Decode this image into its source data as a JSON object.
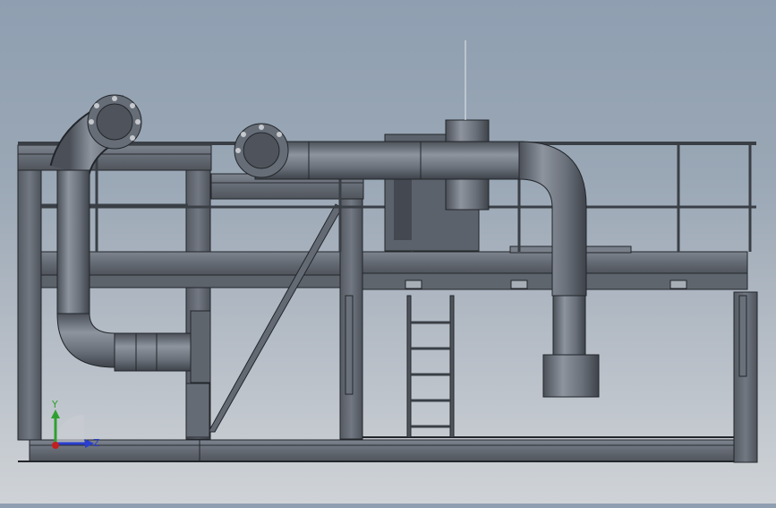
{
  "viewport": {
    "background_top": "#8f9fb1",
    "background_bottom": "#cfd3d7"
  },
  "model": {
    "steel_color": "#6b717b",
    "steel_dark": "#2c3036",
    "steel_light": "#8a919b",
    "pipe_color": "#6d737d",
    "pipe_highlight": "#9aa1aa"
  },
  "triad": {
    "y_label": "Y",
    "z_label": "Z",
    "y_color": "#2fa030",
    "z_color": "#2a3fd0",
    "x_color": "#c02020"
  }
}
